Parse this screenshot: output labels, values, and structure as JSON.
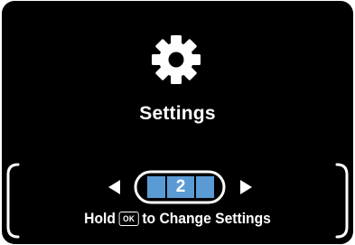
{
  "menu": {
    "title": "Settings",
    "icon": "gear-icon",
    "current_page": "2"
  },
  "hint": {
    "prefix": "Hold",
    "button": "OK",
    "suffix": "to Change Settings"
  },
  "colors": {
    "background": "#000000",
    "text": "#ffffff",
    "page_slot": "#5b9bd5"
  }
}
